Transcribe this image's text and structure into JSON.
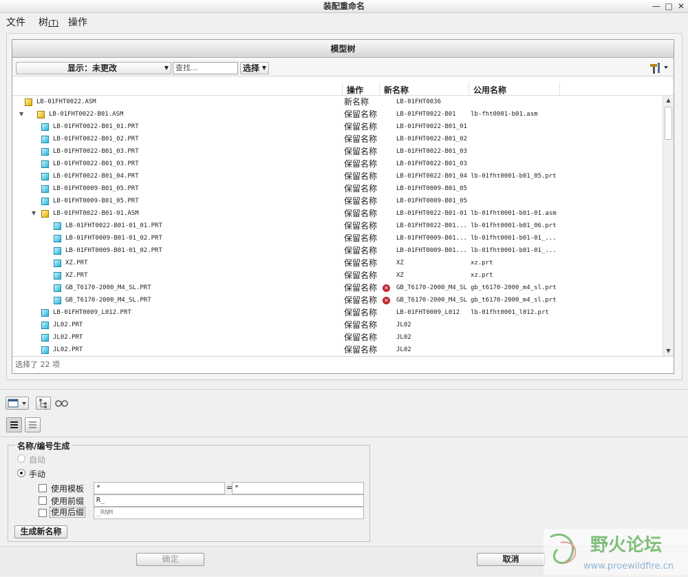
{
  "window": {
    "title": "装配重命名",
    "min": "—",
    "max": "□",
    "close": "✕"
  },
  "menu": [
    {
      "label": "文件"
    },
    {
      "label": "树",
      "mnemonic": "(T)"
    },
    {
      "label": "操作"
    }
  ],
  "tree": {
    "title": "模型树",
    "display_label": "显示：未更改",
    "find_placeholder": "查找...",
    "select_label": "选择",
    "columns": {
      "action": "操作",
      "new_name": "新名称",
      "common_name": "公用名称"
    },
    "rows": [
      {
        "name": "LB-01FHT0022.ASM",
        "type": "asm",
        "level": 0,
        "toggle": "",
        "action": "新名称",
        "new_name": "LB-01FHT0036",
        "common": "",
        "error": false
      },
      {
        "name": "LB-01FHT0022-B01.ASM",
        "type": "asm",
        "level": 0,
        "toggle": "▼",
        "action": "保留名称",
        "new_name": "LB-01FHT0022-B01",
        "common": "lb-fht0001-b01.asm",
        "error": false
      },
      {
        "name": "LB-01FHT0022-B01_01.PRT",
        "type": "prt",
        "level": 1,
        "toggle": "",
        "action": "保留名称",
        "new_name": "LB-01FHT0022-B01_01",
        "common": "",
        "error": false
      },
      {
        "name": "LB-01FHT0022-B01_02.PRT",
        "type": "prt",
        "level": 1,
        "toggle": "",
        "action": "保留名称",
        "new_name": "LB-01FHT0022-B01_02",
        "common": "",
        "error": false
      },
      {
        "name": "LB-01FHT0022-B01_03.PRT",
        "type": "prt",
        "level": 1,
        "toggle": "",
        "action": "保留名称",
        "new_name": "LB-01FHT0022-B01_03",
        "common": "",
        "error": false
      },
      {
        "name": "LB-01FHT0022-B01_03.PRT",
        "type": "prt",
        "level": 1,
        "toggle": "",
        "action": "保留名称",
        "new_name": "LB-01FHT0022-B01_03",
        "common": "",
        "error": false
      },
      {
        "name": "LB-01FHT0022-B01_04.PRT",
        "type": "prt",
        "level": 1,
        "toggle": "",
        "action": "保留名称",
        "new_name": "LB-01FHT0022-B01_04",
        "common": "lb-01fht0001-b01_05.prt",
        "error": false
      },
      {
        "name": "LB-01FHT0009-B01_05.PRT",
        "type": "prt",
        "level": 1,
        "toggle": "",
        "action": "保留名称",
        "new_name": "LB-01FHT0009-B01_05",
        "common": "",
        "error": false
      },
      {
        "name": "LB-01FHT0009-B01_05.PRT",
        "type": "prt",
        "level": 1,
        "toggle": "",
        "action": "保留名称",
        "new_name": "LB-01FHT0009-B01_05",
        "common": "",
        "error": false
      },
      {
        "name": "LB-01FHT0022-B01-01.ASM",
        "type": "asm",
        "level": 1,
        "toggle": "▼",
        "action": "保留名称",
        "new_name": "LB-01FHT0022-B01-01",
        "common": "lb-01fht0001-b01-01.asm",
        "error": false
      },
      {
        "name": "LB-01FHT0022-B01-01_01.PRT",
        "type": "prt",
        "level": 2,
        "toggle": "",
        "action": "保留名称",
        "new_name": "LB-01FHT0022-B01...",
        "common": "lb-01fht0001-b01_06.prt",
        "error": false
      },
      {
        "name": "LB-01FHT0009-B01-01_02.PRT",
        "type": "prt",
        "level": 2,
        "toggle": "",
        "action": "保留名称",
        "new_name": "LB-01FHT0009-B01...",
        "common": "lb-01fht0001-b01-01_...",
        "error": false
      },
      {
        "name": "LB-01FHT0009-B01-01_02.PRT",
        "type": "prt",
        "level": 2,
        "toggle": "",
        "action": "保留名称",
        "new_name": "LB-01FHT0009-B01...",
        "common": "lb-01fht0001-b01-01_...",
        "error": false
      },
      {
        "name": "XZ.PRT",
        "type": "prt",
        "level": 2,
        "toggle": "",
        "action": "保留名称",
        "new_name": "XZ",
        "common": "xz.prt",
        "error": false
      },
      {
        "name": "XZ.PRT",
        "type": "prt",
        "level": 2,
        "toggle": "",
        "action": "保留名称",
        "new_name": "XZ",
        "common": "xz.prt",
        "error": false
      },
      {
        "name": "GB_T6170-2000_M4_SL.PRT",
        "type": "prt",
        "level": 2,
        "toggle": "",
        "action": "保留名称",
        "new_name": "GB_T6170-2000_M4_SL",
        "common": "gb_t6170-2000_m4_sl.prt",
        "error": true
      },
      {
        "name": "GB_T6170-2000_M4_SL.PRT",
        "type": "prt",
        "level": 2,
        "toggle": "",
        "action": "保留名称",
        "new_name": "GB_T6170-2000_M4_SL",
        "common": "gb_t6170-2000_m4_sl.prt",
        "error": true
      },
      {
        "name": "LB-01FHT0009_L012.PRT",
        "type": "prt",
        "level": 1,
        "toggle": "",
        "action": "保留名称",
        "new_name": "LB-01FHT0009_L012",
        "common": "lb-01fht0001_l012.prt",
        "error": false
      },
      {
        "name": "JL02.PRT",
        "type": "prt",
        "level": 1,
        "toggle": "",
        "action": "保留名称",
        "new_name": "JL02",
        "common": "",
        "error": false
      },
      {
        "name": "JL02.PRT",
        "type": "prt",
        "level": 1,
        "toggle": "",
        "action": "保留名称",
        "new_name": "JL02",
        "common": "",
        "error": false
      },
      {
        "name": "JL02.PRT",
        "type": "prt",
        "level": 1,
        "toggle": "",
        "action": "保留名称",
        "new_name": "JL02",
        "common": "",
        "error": false
      }
    ],
    "status": "选择了 22 项"
  },
  "naming": {
    "group_title": "名称/编号生成",
    "auto_label": "自动",
    "manual_label": "手动",
    "manual_selected": true,
    "use_template_label": "使用模板",
    "use_prefix_label": "使用前缀",
    "use_suffix_label": "使用后缀",
    "template_left": "*",
    "template_eq": "=",
    "template_right": "*",
    "prefix_value": "R_",
    "suffix_placeholder": "_RNM",
    "generate_button": "生成新名称"
  },
  "footer": {
    "ok": "确定",
    "cancel": "取消"
  },
  "watermark": {
    "title": "野火论坛",
    "url": "www.proewildfire.cn"
  },
  "colors": {
    "error": "#c0272d",
    "asm_icon": "#e0b200",
    "prt_icon": "#2bb4d8",
    "watermark": "#7fbf7a"
  }
}
